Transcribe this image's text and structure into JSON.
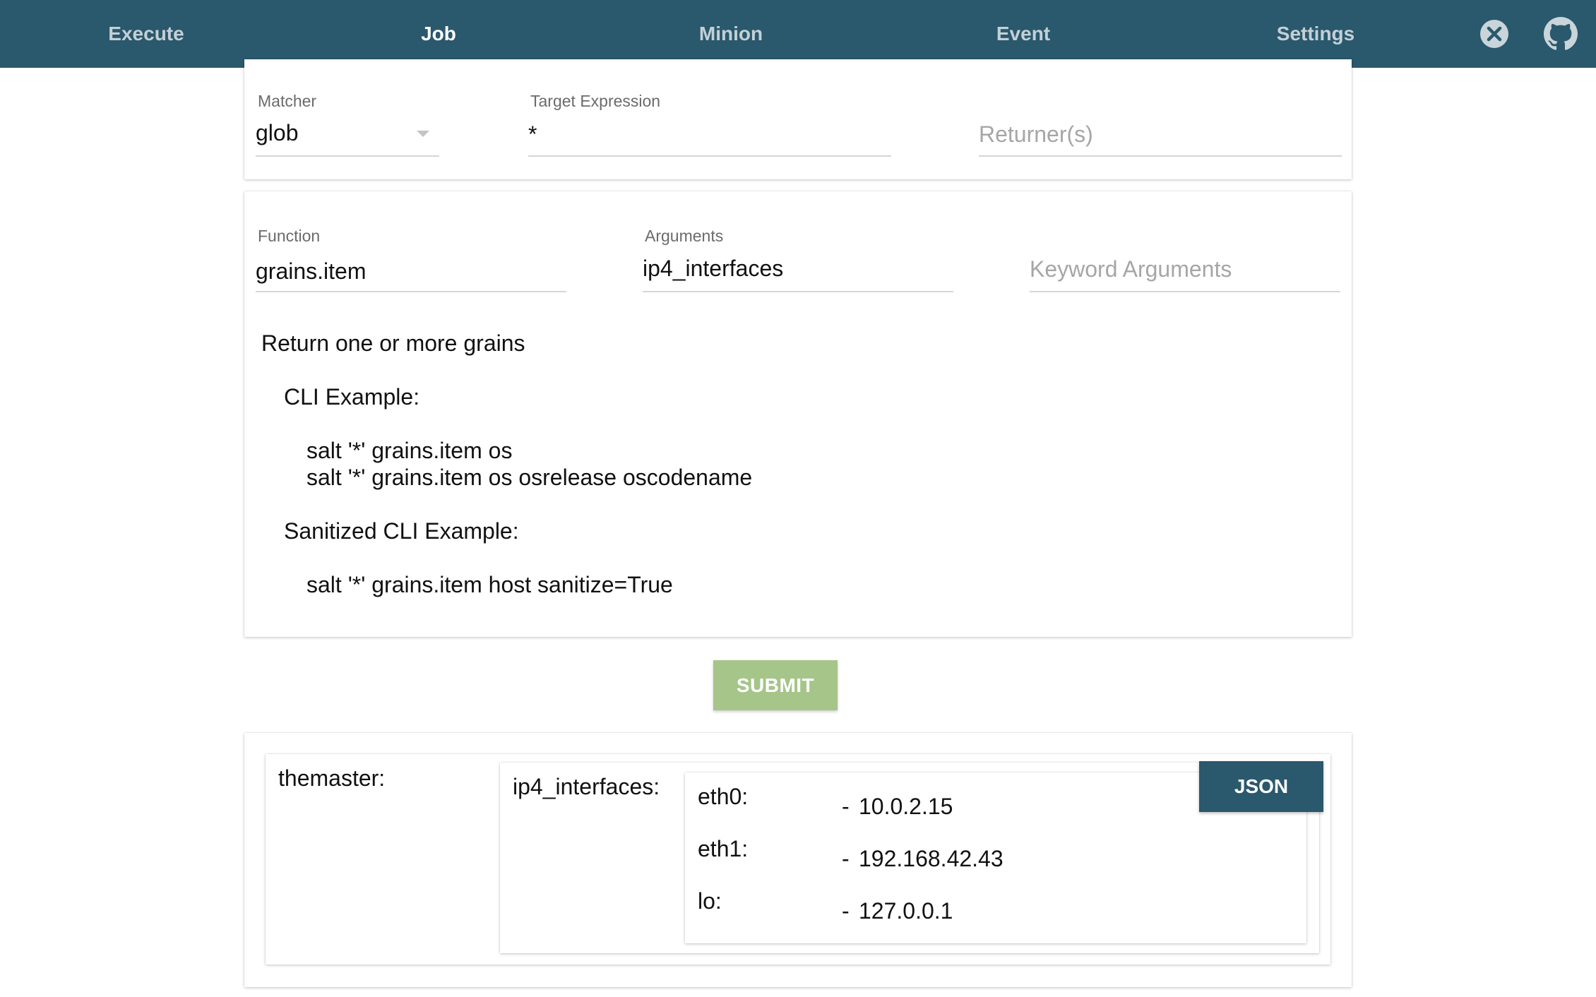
{
  "nav": {
    "tabs": [
      "Execute",
      "Job",
      "Minion",
      "Event",
      "Settings"
    ],
    "active_tab": "Job",
    "icons": [
      "close-circle-icon",
      "github-icon"
    ]
  },
  "target_card": {
    "matcher_label": "Matcher",
    "matcher_value": "glob",
    "target_label": "Target Expression",
    "target_value": "*",
    "returner_placeholder": "Returner(s)"
  },
  "function_card": {
    "function_label": "Function",
    "function_value": "grains.item",
    "arguments_label": "Arguments",
    "arguments_value": "ip4_interfaces",
    "kwargs_placeholder": "Keyword Arguments",
    "doc": {
      "summary": "Return one or more grains",
      "cli_heading": "CLI Example:",
      "cli_lines": [
        "salt '*' grains.item os",
        "salt '*' grains.item os osrelease oscodename"
      ],
      "sanitized_heading": "Sanitized CLI Example:",
      "sanitized_line": "salt '*' grains.item host sanitize=True"
    }
  },
  "submit_label": "SUBMIT",
  "result": {
    "minion": "themaster:",
    "grain": "ip4_interfaces:",
    "json_label": "JSON",
    "interfaces": [
      {
        "name": "eth0:",
        "dash": "-",
        "ip": "10.0.2.15"
      },
      {
        "name": "eth1:",
        "dash": "-",
        "ip": "192.168.42.43"
      },
      {
        "name": "lo:",
        "dash": "-",
        "ip": "127.0.0.1"
      }
    ]
  },
  "colors": {
    "topbar": "#2a586d",
    "tab_indicator": "#8bc34a",
    "submit_bg": "#a5c589",
    "json_bg": "#2a586d"
  }
}
